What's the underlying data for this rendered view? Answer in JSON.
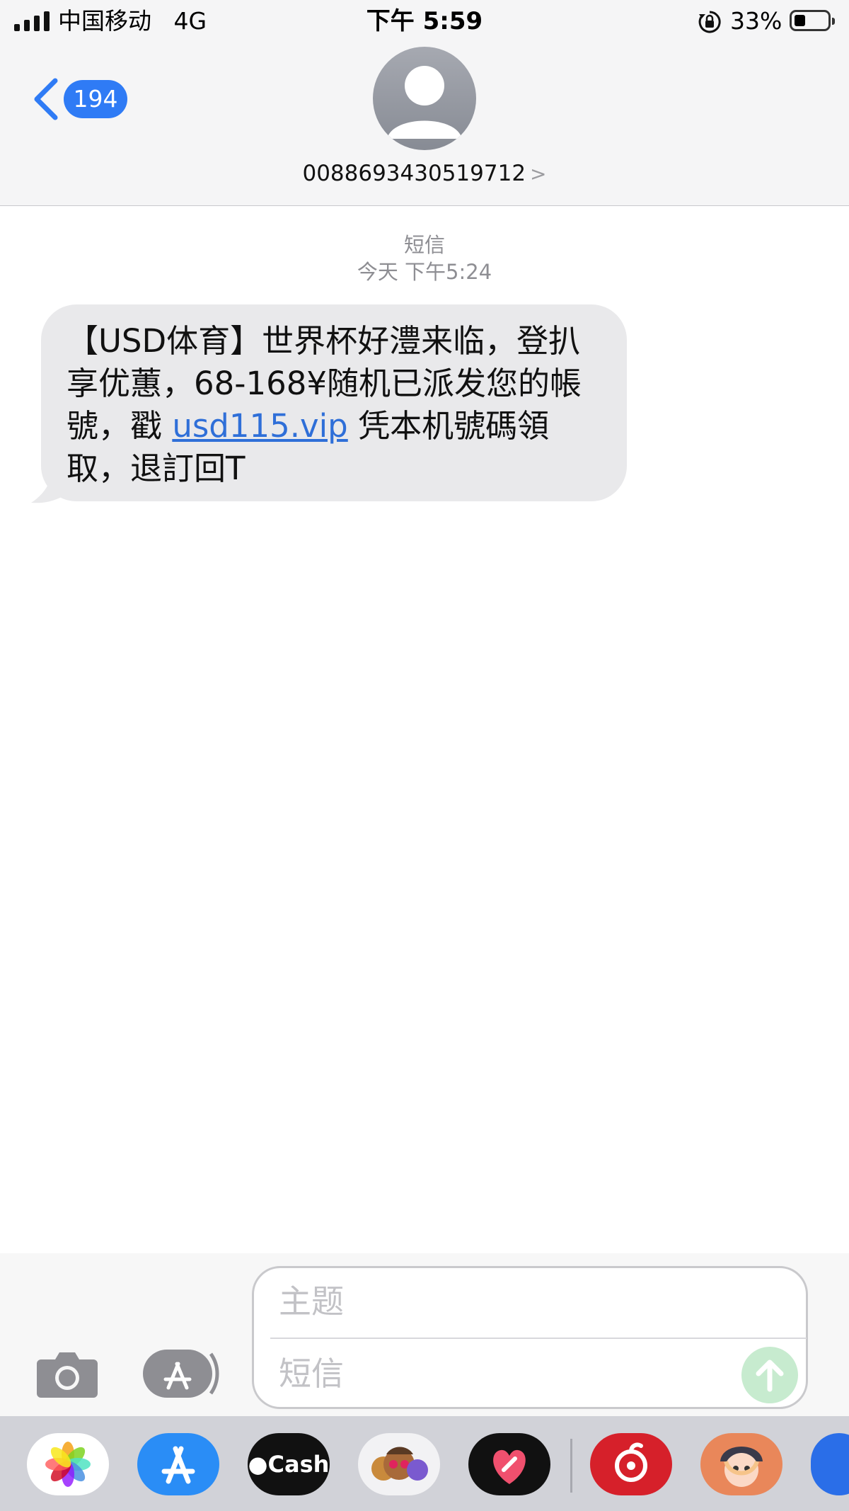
{
  "status_bar": {
    "carrier": "中国移动",
    "network": "4G",
    "time": "下午 5:59",
    "battery_percent": "33%",
    "battery_level": 0.33
  },
  "header": {
    "back_count": "194",
    "contact": "0088693430519712"
  },
  "conversation": {
    "type_label": "短信",
    "timestamp": "今天 下午5:24",
    "message": {
      "part1": "【USD体育】世界杯好澧来临，登扒享优蕙，68-168¥随机已派发您的帳號，戳",
      "link": "usd115.vip",
      "part2": "凭本机號碼領取，退訂回T"
    }
  },
  "composer": {
    "subject_placeholder": "主题",
    "body_placeholder": "短信"
  },
  "app_drawer": {
    "apps": [
      "photos-icon",
      "app-store-icon",
      "apple-cash-icon",
      "memoji-icon",
      "digital-touch-icon",
      "netease-music-icon",
      "anime-sticker-icon",
      "more-app-icon"
    ],
    "cash_label": "Cash"
  },
  "colors": {
    "accent": "#2f7bf5",
    "bubble": "#e9e9eb",
    "link": "#2f6fd8",
    "send": "#c7ebcf"
  }
}
